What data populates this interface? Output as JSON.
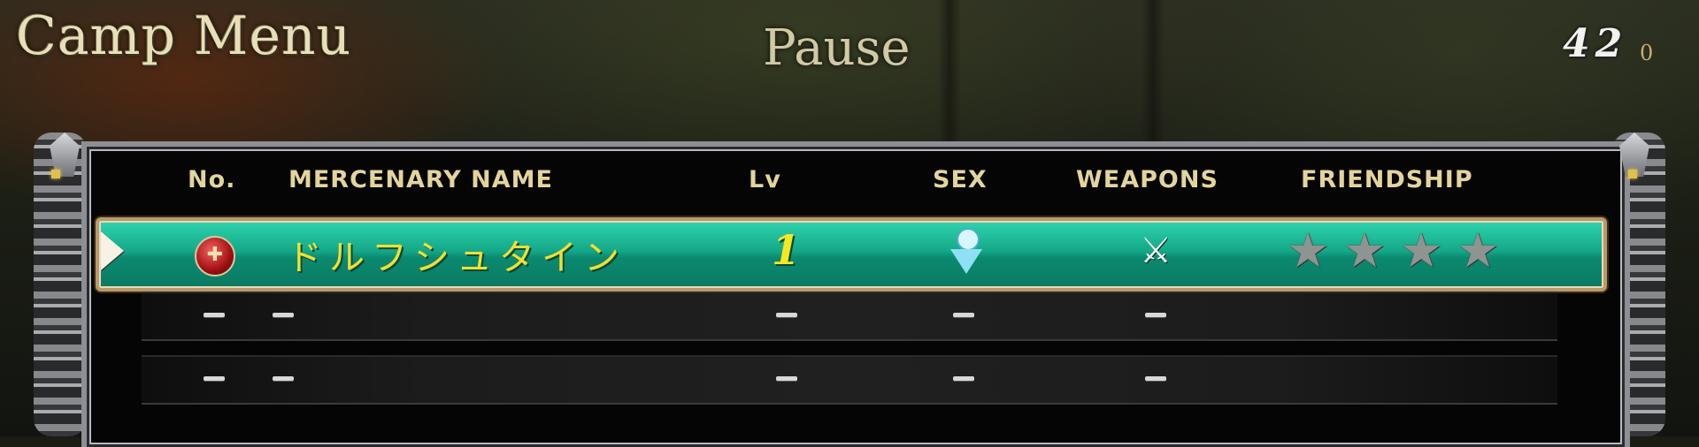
{
  "header": {
    "camp_title": "Camp Menu",
    "pause_title": "Pause",
    "money_value": "42",
    "money_unit": "0"
  },
  "columns": {
    "no": "No.",
    "name": "MERCENARY  NAME",
    "lv": "Lv",
    "sex": "SEX",
    "weapons": "WEAPONS",
    "friendship": "FRIENDSHIP"
  },
  "mercenaries": [
    {
      "name": "ドルフシュタイン",
      "level": "1",
      "sex_icon": "female-icon",
      "weapon_icon": "sword-icon",
      "friendship_stars": 0,
      "friendship_max": 4,
      "selected": true
    },
    {
      "no": "–",
      "name": "–",
      "level": "–",
      "sex": "–",
      "weapons": "–",
      "empty": true
    },
    {
      "no": "–",
      "name": "–",
      "level": "–",
      "sex": "–",
      "weapons": "–",
      "empty": true
    }
  ],
  "colors": {
    "selected_row": "#14a888",
    "header_text": "#e3d49c",
    "name_text": "#f0e030",
    "star_empty": "#8e9491"
  }
}
